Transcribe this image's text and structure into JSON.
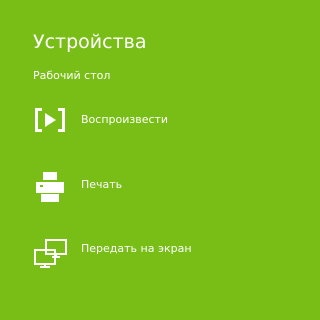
{
  "panel": {
    "title": "Устройства",
    "section": "Рабочий стол",
    "background": "#78be16"
  },
  "items": [
    {
      "label": "Воспроизвести",
      "icon": "play-to-device-icon"
    },
    {
      "label": "Печать",
      "icon": "printer-icon"
    },
    {
      "label": "Передать на экран",
      "icon": "project-to-screen-icon"
    }
  ]
}
